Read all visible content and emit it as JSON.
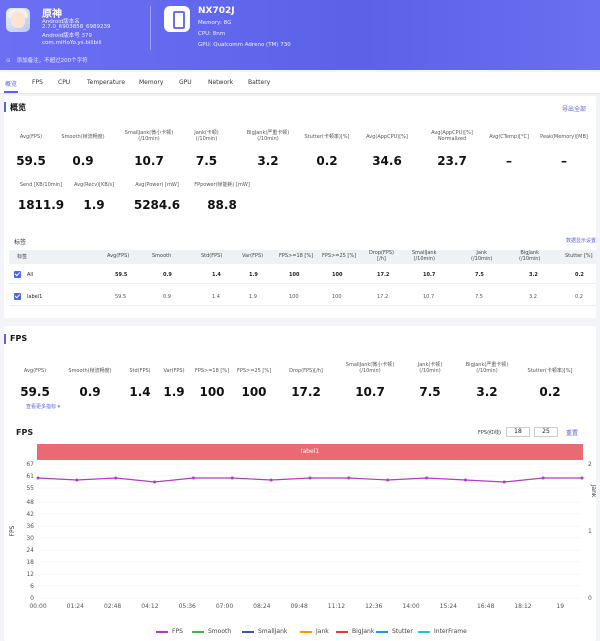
{
  "app": {
    "name": "原神",
    "lines": [
      "Android版本名",
      "2.7.0_6903858_6989239",
      "Android版本号 379",
      "com.miHoYo.ys.bilibili"
    ]
  },
  "device": {
    "name": "NX702J",
    "lines": [
      "Memory: 8G",
      "CPU: 8nm",
      "GPU: Qualcomm Adreno (TM) 730"
    ]
  },
  "remark": "添加备注，不超过200个字符",
  "tabs": [
    "概览",
    "FPS",
    "CPU",
    "Temperature",
    "Memory",
    "GPU",
    "Network",
    "Battery"
  ],
  "overview": {
    "title": "概览",
    "export": "导出全部",
    "metrics_row1": [
      {
        "label": "Avg(FPS)",
        "value": "59.5"
      },
      {
        "label": "Smooth(帧流畅度)",
        "value": "0.9"
      },
      {
        "label": "SmallJank(微小卡顿)\n(/10min)",
        "value": "10.7"
      },
      {
        "label": "Jank(卡顿)\n(/10min)",
        "value": "7.5"
      },
      {
        "label": "BigJank(严重卡顿)\n(/10min)",
        "value": "3.2"
      },
      {
        "label": "Stutter(卡顿率)[%]",
        "value": "0.2"
      },
      {
        "label": "Avg(AppCPU)[%]",
        "value": "34.6"
      },
      {
        "label": "Avg(AppCPU)[%]\nNormalized",
        "value": "23.7"
      },
      {
        "label": "Avg(CTemp)[°C]",
        "value": "–"
      },
      {
        "label": "Peak(Memory)[MB]",
        "value": "–"
      }
    ],
    "metrics_row2": [
      {
        "label": "Send [KB/10min]",
        "value": "1811.9"
      },
      {
        "label": "Avg(Recv)[KB/s]",
        "value": "1.9"
      },
      {
        "label": "Avg(Power) [mW]",
        "value": "5284.6"
      },
      {
        "label": "FPpower(帧能耗) [mW]",
        "value": "88.8"
      }
    ]
  },
  "table": {
    "title": "标签",
    "right_link": "数据显示设置",
    "headers": [
      "标签",
      "Avg(FPS)",
      "Smooth",
      "Std(FPS)",
      "Var(FPS)",
      "FPS>=18 [%]",
      "FPS>=25 [%]",
      "Drop(FPS)\n[/h]",
      "SmallJank\n(/10min)",
      "Jank\n(/10min)",
      "BigJank\n(/10min)",
      "Stutter [%]"
    ],
    "rows": [
      [
        "All",
        "59.5",
        "0.9",
        "1.4",
        "1.9",
        "100",
        "100",
        "17.2",
        "10.7",
        "7.5",
        "3.2",
        "0.2"
      ],
      [
        "label1",
        "59.5",
        "0.9",
        "1.4",
        "1.9",
        "100",
        "100",
        "17.2",
        "10.7",
        "7.5",
        "3.2",
        "0.2"
      ]
    ]
  },
  "fps_section": {
    "title": "FPS",
    "metrics": [
      {
        "label": "Avg(FPS)",
        "value": "59.5"
      },
      {
        "label": "Smooth(帧流畅度)",
        "value": "0.9"
      },
      {
        "label": "Std(FPS)",
        "value": "1.4"
      },
      {
        "label": "Var(FPS)",
        "value": "1.9"
      },
      {
        "label": "FPS>=18 [%]",
        "value": "100"
      },
      {
        "label": "FPS>=25 [%]",
        "value": "100"
      },
      {
        "label": "Drop(FPS)[/h]",
        "value": "17.2"
      },
      {
        "label": "SmallJank(微小卡顿)\n(/10min)",
        "value": "10.7"
      },
      {
        "label": "Jank(卡顿)\n(/10min)",
        "value": "7.5"
      },
      {
        "label": "BigJank(严重卡顿)\n(/10min)",
        "value": "3.2"
      },
      {
        "label": "Stutter(卡顿率)[%]",
        "value": "0.2"
      }
    ],
    "expand": "查看更多指标",
    "chart_title": "FPS",
    "fps_range_label": "FPS(红线)",
    "fps_low": "18",
    "fps_high": "25",
    "reset": "重置",
    "label_bar": "label1"
  },
  "chart_data": {
    "type": "line",
    "title": "FPS",
    "ylabel": "FPS",
    "y2label": "Jank",
    "ylim": [
      0,
      67
    ],
    "y2lim": [
      0,
      2
    ],
    "yticks": [
      0,
      6,
      12,
      18,
      24,
      30,
      36,
      42,
      48,
      55,
      61,
      67
    ],
    "y2ticks": [
      0,
      1,
      2
    ],
    "x": [
      "00:00",
      "01:24",
      "02:48",
      "04:12",
      "05:36",
      "07:00",
      "08:24",
      "09:48",
      "11:12",
      "12:36",
      "14:00",
      "15:24",
      "16:48",
      "18:12",
      "19"
    ],
    "series": [
      {
        "name": "FPS",
        "color": "#b13cbf",
        "values": [
          60,
          59,
          60,
          58,
          60,
          60,
          59,
          60,
          60,
          59,
          60,
          59,
          58,
          60,
          60
        ]
      },
      {
        "name": "Smooth",
        "color": "#4caf50"
      },
      {
        "name": "SmallJank",
        "color": "#3f51b5"
      },
      {
        "name": "Jank",
        "color": "#ff9800"
      },
      {
        "name": "BigJank",
        "color": "#e53935"
      },
      {
        "name": "Stutter",
        "color": "#2196f3"
      },
      {
        "name": "InterFrame",
        "color": "#26c6da"
      }
    ]
  }
}
